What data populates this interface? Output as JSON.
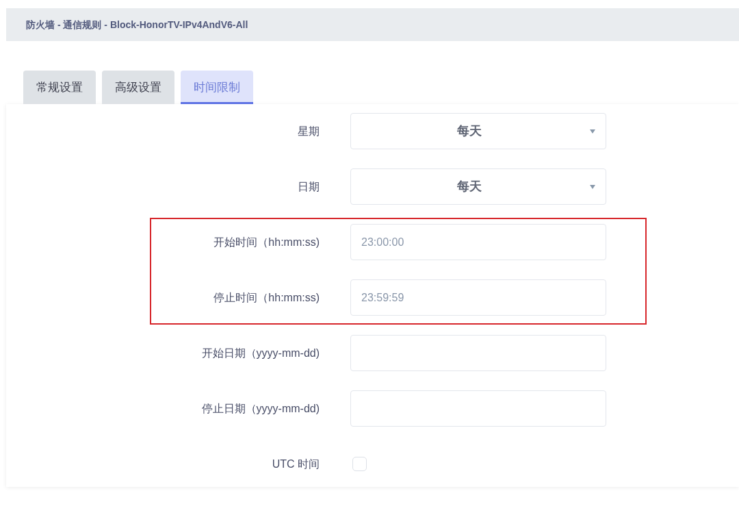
{
  "header": {
    "title": "防火墙 - 通信规则 - Block-HonorTV-IPv4AndV6-All"
  },
  "tabs": [
    {
      "label": "常规设置",
      "selected": false
    },
    {
      "label": "高级设置",
      "selected": false
    },
    {
      "label": "时间限制",
      "selected": true
    }
  ],
  "form": {
    "rows": [
      {
        "kind": "select",
        "label": "星期",
        "value": "每天",
        "highlighted": false
      },
      {
        "kind": "select",
        "label": "日期",
        "value": "每天",
        "highlighted": false
      },
      {
        "kind": "input",
        "label": "开始时间（hh:mm:ss)",
        "value": "23:00:00",
        "highlighted": true
      },
      {
        "kind": "input",
        "label": "停止时间（hh:mm:ss)",
        "value": "23:59:59",
        "highlighted": true
      },
      {
        "kind": "input",
        "label": "开始日期（yyyy-mm-dd)",
        "highlighted": false
      },
      {
        "kind": "input",
        "label": "停止日期（yyyy-mm-dd)",
        "highlighted": false
      },
      {
        "kind": "checkbox",
        "label": "UTC 时间",
        "checked": false,
        "highlighted": false
      }
    ]
  }
}
